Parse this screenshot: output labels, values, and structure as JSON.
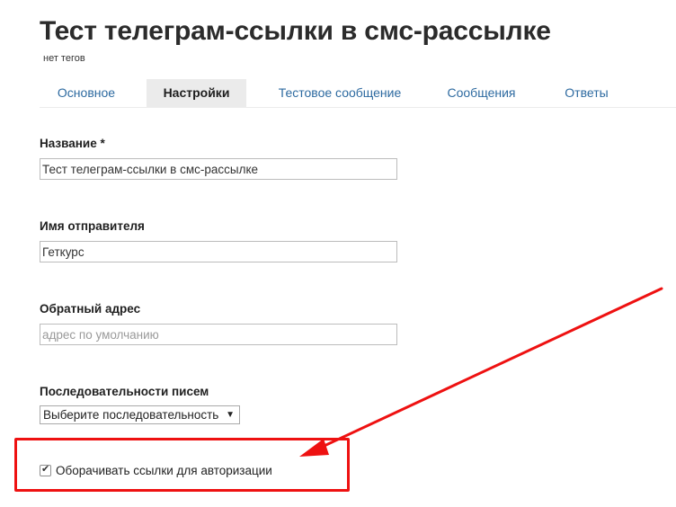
{
  "page": {
    "title": "Тест телеграм-ссылки в смс-рассылке",
    "tags": "нет тегов"
  },
  "tabs": [
    {
      "label": "Основное",
      "active": false
    },
    {
      "label": "Настройки",
      "active": true
    },
    {
      "label": "Тестовое сообщение",
      "active": false
    },
    {
      "label": "Сообщения",
      "active": false
    },
    {
      "label": "Ответы",
      "active": false
    }
  ],
  "form": {
    "name_label": "Название *",
    "name_value": "Тест телеграм-ссылки в смс-рассылке",
    "sender_label": "Имя отправителя",
    "sender_value": "Геткурс",
    "reply_label": "Обратный адрес",
    "reply_value": "",
    "reply_placeholder": "адрес по умолчанию",
    "sequence_label": "Последовательности писем",
    "sequence_selected": "Выберите последовательность",
    "wrap_links_label": "Оборачивать ссылки для авторизации",
    "wrap_links_checked": true
  },
  "annotation": {
    "color": "#ee1111"
  }
}
